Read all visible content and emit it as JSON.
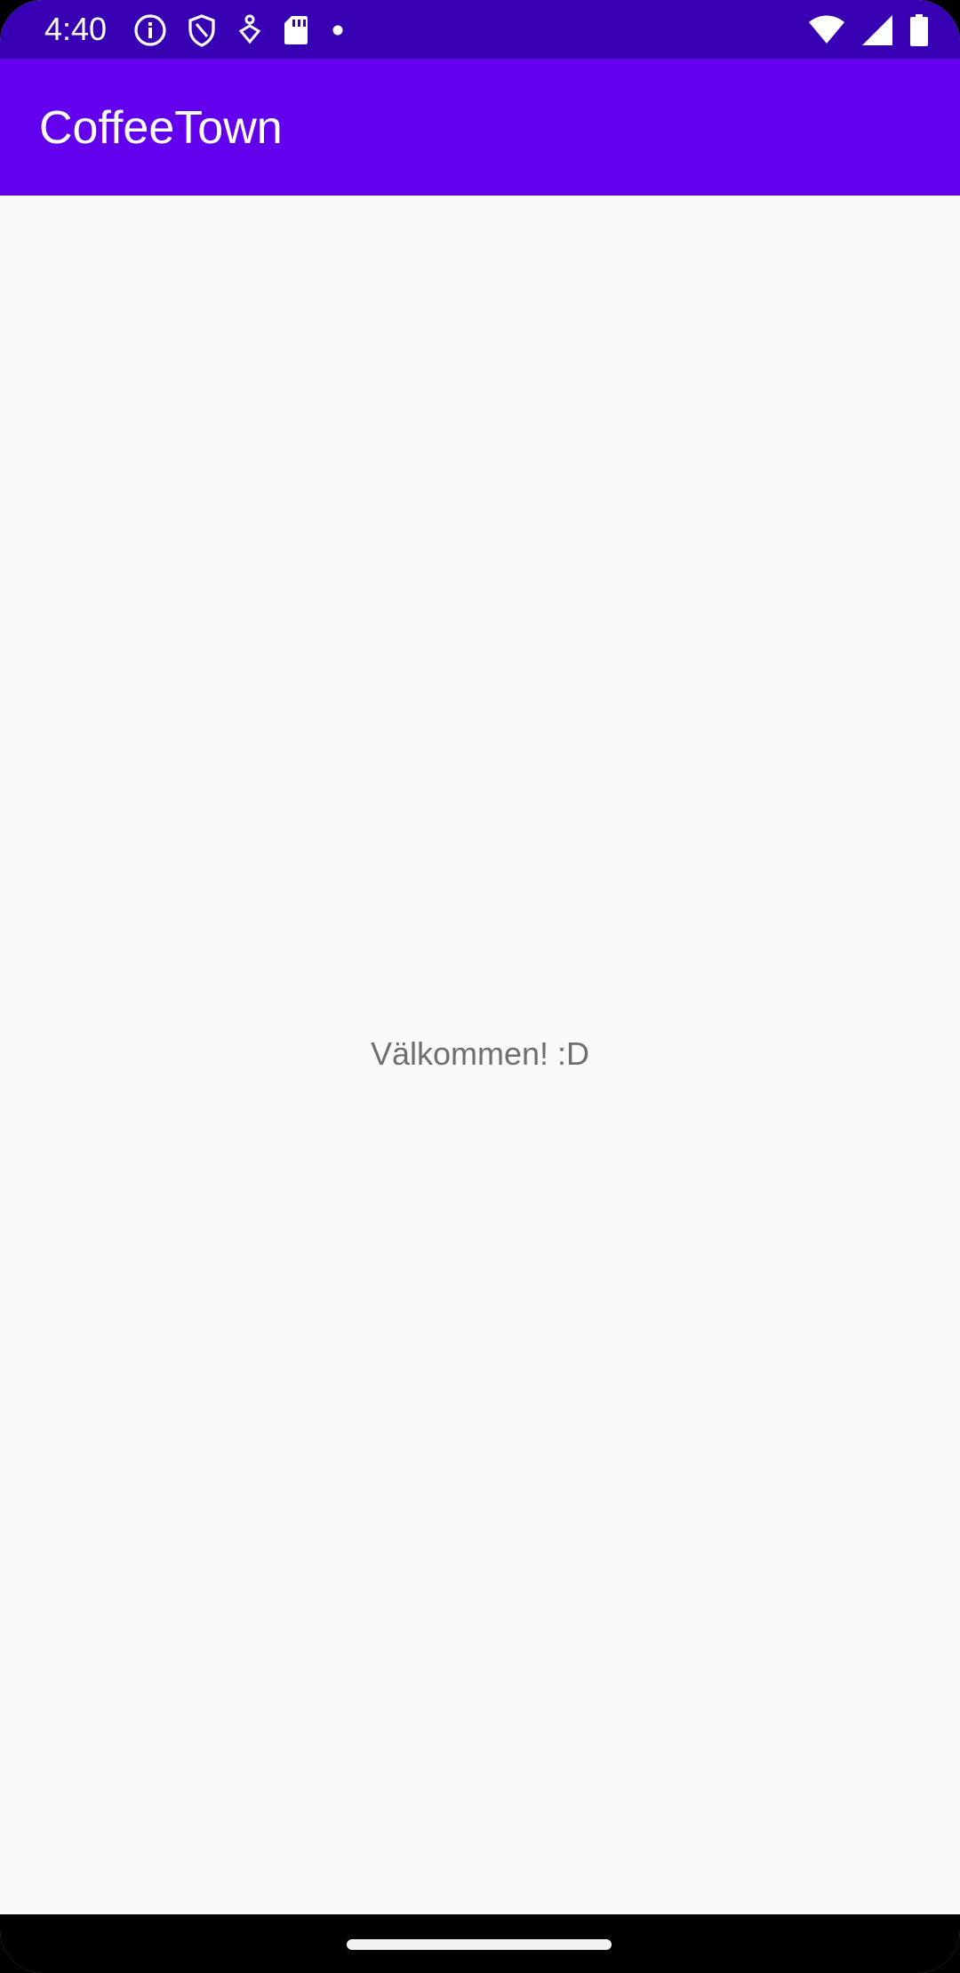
{
  "status_bar": {
    "time": "4:40",
    "left_icons": [
      "info-icon",
      "shield-icon",
      "accessibility-icon",
      "sd-card-icon",
      "dot-icon"
    ],
    "right_icons": [
      "wifi-icon",
      "signal-icon",
      "battery-icon"
    ],
    "background": "#3700b3"
  },
  "app_bar": {
    "title": "CoffeeTown",
    "background": "#6200ee"
  },
  "main": {
    "welcome_text": "Välkommen! :D",
    "text_color": "#6f6f6f",
    "background": "#fafafa"
  },
  "nav_bar": {
    "background": "#000000"
  }
}
